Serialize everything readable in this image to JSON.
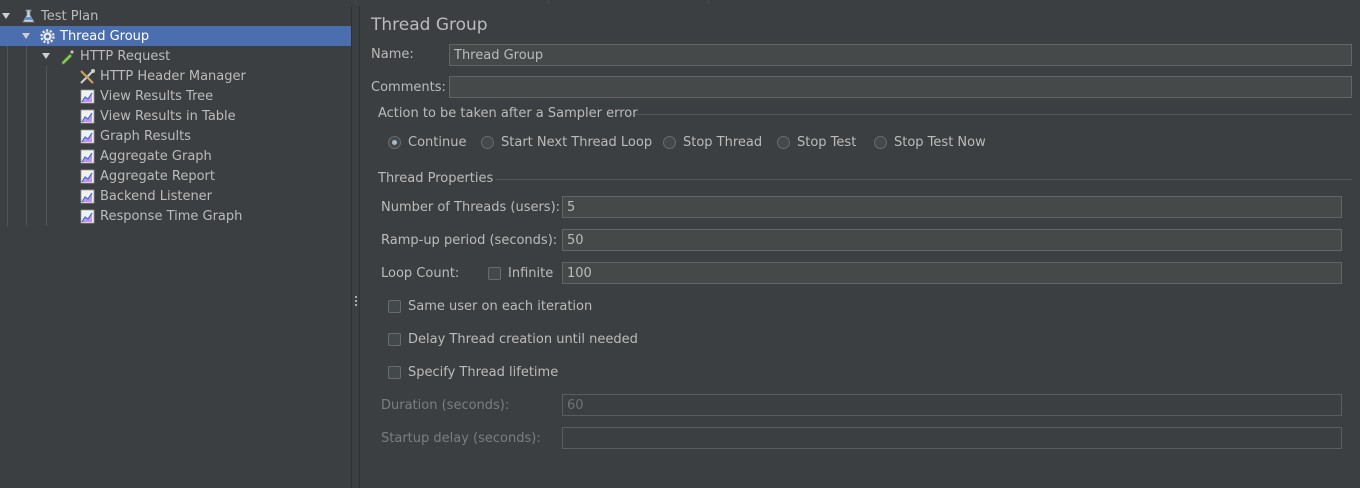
{
  "tree": {
    "nodes": [
      {
        "label": "Test Plan",
        "icon": "flask-icon"
      },
      {
        "label": "Thread Group",
        "icon": "gear-icon",
        "selected": true
      },
      {
        "label": "HTTP Request",
        "icon": "pipette-icon"
      },
      {
        "label": "HTTP Header Manager",
        "icon": "tools-icon"
      },
      {
        "label": "View Results Tree",
        "icon": "graph-icon"
      },
      {
        "label": "View Results in Table",
        "icon": "graph-icon"
      },
      {
        "label": "Graph Results",
        "icon": "graph-icon"
      },
      {
        "label": "Aggregate Graph",
        "icon": "graph-icon"
      },
      {
        "label": "Aggregate Report",
        "icon": "graph-icon"
      },
      {
        "label": "Backend Listener",
        "icon": "graph-icon"
      },
      {
        "label": "Response Time Graph",
        "icon": "graph-icon"
      }
    ]
  },
  "panel": {
    "title": "Thread Group",
    "name_label": "Name:",
    "name_value": "Thread Group",
    "comments_label": "Comments:",
    "comments_value": "",
    "sampler_error": {
      "title": "Action to be taken after a Sampler error",
      "options": [
        "Continue",
        "Start Next Thread Loop",
        "Stop Thread",
        "Stop Test",
        "Stop Test Now"
      ],
      "selected": "Continue"
    },
    "thread_props": {
      "title": "Thread Properties",
      "threads_label": "Number of Threads (users):",
      "threads_value": "5",
      "rampup_label": "Ramp-up period (seconds):",
      "rampup_value": "50",
      "loop_label": "Loop Count:",
      "infinite_label": "Infinite",
      "loop_value": "100",
      "same_user_label": "Same user on each iteration",
      "delay_label": "Delay Thread creation until needed",
      "lifetime_label": "Specify Thread lifetime",
      "duration_label": "Duration (seconds):",
      "duration_value": "60",
      "startup_label": "Startup delay (seconds):",
      "startup_value": ""
    }
  },
  "colors": {
    "background": "#3c3f41",
    "selection": "#4b6eaf",
    "field_bg": "#45494a",
    "text": "#bbbbbb"
  }
}
